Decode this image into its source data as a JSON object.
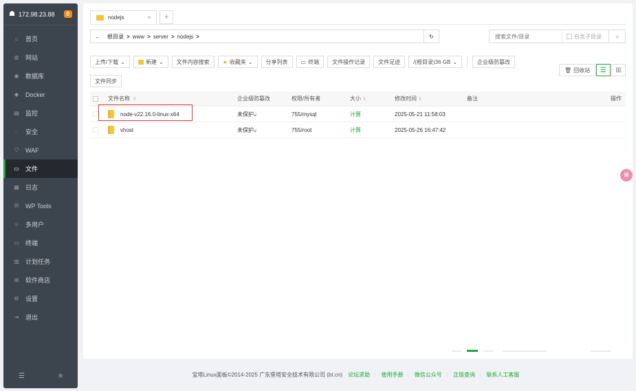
{
  "sidebar": {
    "ip": "172.98.23.88",
    "badge": "0",
    "items": [
      {
        "label": "首页",
        "icon": "home-icon"
      },
      {
        "label": "网站",
        "icon": "globe-icon"
      },
      {
        "label": "数据库",
        "icon": "database-icon"
      },
      {
        "label": "Docker",
        "icon": "docker-icon"
      },
      {
        "label": "监控",
        "icon": "monitor-icon"
      },
      {
        "label": "安全",
        "icon": "shield-icon"
      },
      {
        "label": "WAF",
        "icon": "waf-icon"
      },
      {
        "label": "文件",
        "icon": "folder-icon",
        "active": true
      },
      {
        "label": "日志",
        "icon": "log-icon"
      },
      {
        "label": "WP Tools",
        "icon": "wordpress-icon"
      },
      {
        "label": "多用户",
        "icon": "users-icon"
      },
      {
        "label": "终端",
        "icon": "terminal-icon"
      },
      {
        "label": "计划任务",
        "icon": "calendar-icon"
      },
      {
        "label": "软件商店",
        "icon": "grid-icon"
      },
      {
        "label": "设置",
        "icon": "gear-icon"
      },
      {
        "label": "退出",
        "icon": "logout-icon"
      }
    ]
  },
  "tab": {
    "label": "nodejs",
    "close": "×",
    "add": "+"
  },
  "path": {
    "back": "←",
    "crumbs": [
      "根目录",
      "www",
      "server",
      "nodejs"
    ],
    "sep": ">",
    "refresh": "↻"
  },
  "search": {
    "placeholder": "搜索文件/目录",
    "subdir_label": "包含子目录"
  },
  "toolbar": {
    "upload": "上传/下载",
    "new": "新建",
    "content_search": "文件内容搜索",
    "favorites": "收藏夹",
    "share_list": "分享列表",
    "terminal": "终端",
    "op_log": "文件操作记录",
    "footprint": "文件足迹",
    "disk": "/(根目录)36 GB",
    "tamper": "企业级防篡改",
    "sync": "文件同步",
    "recycle": "回收站"
  },
  "table": {
    "headers": {
      "name": "文件名称",
      "protect": "企业级防篡改",
      "perm": "权限/所有者",
      "size": "大小",
      "mtime": "修改时间",
      "note": "备注",
      "op": "操作"
    },
    "rows": [
      {
        "name": "node-v22.16.0-linux-x64",
        "protect": "未保护",
        "perm": "755/mysql",
        "size": "计算",
        "mtime": "2025-05-21 11:58:03"
      },
      {
        "name": "vhost",
        "protect": "未保护",
        "perm": "755/root",
        "size": "计算",
        "mtime": "2025-05-26 16:47:42"
      }
    ]
  },
  "footer": {
    "copyright": "宝塔Linux面板©2014-2025 广东堡塔安全技术有限公司 (bt.cn)",
    "links": [
      "论坛求助",
      "使用手册",
      "微信公众号",
      "正版查询",
      "联系人工客服"
    ]
  },
  "float_badge": "译"
}
